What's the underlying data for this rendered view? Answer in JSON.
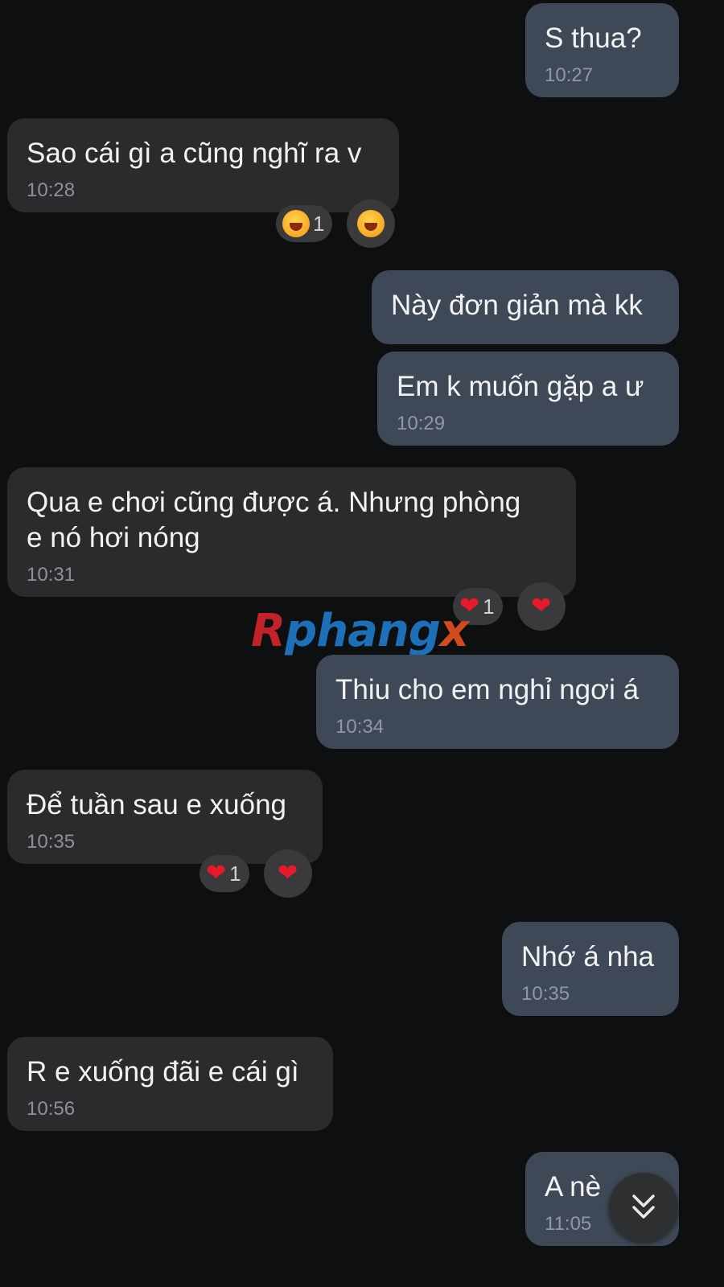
{
  "colors": {
    "background": "#0e0f11",
    "incoming_bubble": "#2b2b2d",
    "outgoing_bubble": "#3e4856",
    "heart": "#e8192c"
  },
  "messages": [
    {
      "direction": "out",
      "text": "S thua?",
      "time": "10:27"
    },
    {
      "direction": "in",
      "text": "Sao cái gì a cũng nghĩ ra v",
      "time": "10:28",
      "reaction": {
        "emoji": "laughing-face",
        "count": "1"
      }
    },
    {
      "direction": "out",
      "text": "Này đơn giản mà kk",
      "time": ""
    },
    {
      "direction": "out",
      "text": "Em k muốn gặp a ư",
      "time": "10:29"
    },
    {
      "direction": "in",
      "text": "Qua e chơi cũng được á. Nhưng phòng\ne nó hơi nóng",
      "time": "10:31",
      "reaction": {
        "emoji": "heart",
        "count": "1"
      }
    },
    {
      "direction": "out",
      "text": "Thiu cho em nghỉ ngơi á",
      "time": "10:34"
    },
    {
      "direction": "in",
      "text": "Để tuần sau e xuống",
      "time": "10:35",
      "reaction": {
        "emoji": "heart",
        "count": "1"
      }
    },
    {
      "direction": "out",
      "text": "Nhớ á nha",
      "time": "10:35"
    },
    {
      "direction": "in",
      "text": "R e xuống đãi e cái gì",
      "time": "10:56"
    },
    {
      "direction": "out",
      "text": "A nè",
      "time": "11:05"
    }
  ],
  "watermark": {
    "part1": "R",
    "part2": "phang",
    "part3": "x"
  },
  "scroll_button": {
    "icon": "double-chevron-down-icon"
  }
}
